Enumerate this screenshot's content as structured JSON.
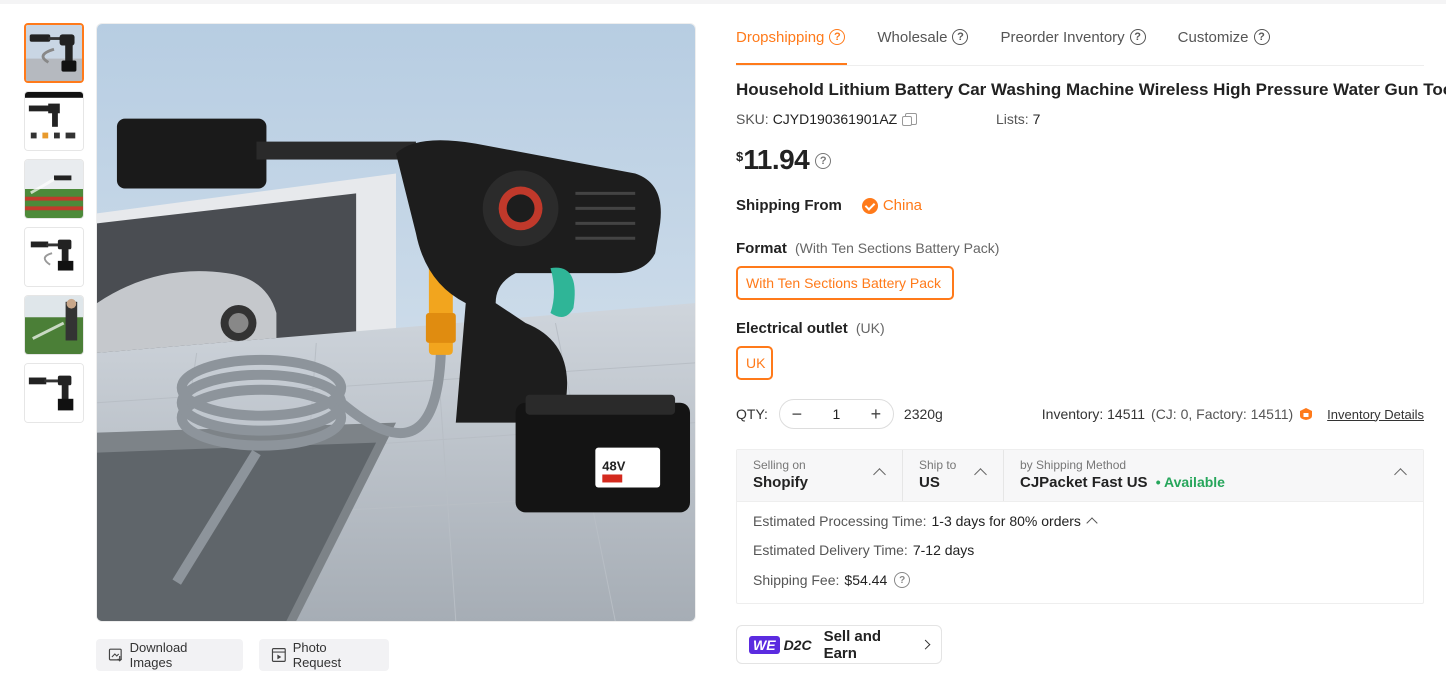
{
  "tabs": [
    {
      "label": "Dropshipping",
      "active": true
    },
    {
      "label": "Wholesale",
      "active": false
    },
    {
      "label": "Preorder Inventory",
      "active": false
    },
    {
      "label": "Customize",
      "active": false
    }
  ],
  "product": {
    "title": "Household Lithium Battery Car Washing Machine Wireless High Pressure Water Gun Tool",
    "sku_label": "SKU:",
    "sku": "CJYD190361901AZ",
    "lists_label": "Lists:",
    "lists": "7",
    "currency": "$",
    "price": "11.94"
  },
  "shipping_from": {
    "label": "Shipping From",
    "country": "China"
  },
  "format": {
    "label": "Format",
    "selected_hint": "(With Ten Sections Battery Pack)",
    "option": "With Ten Sections Battery Pack"
  },
  "outlet": {
    "label": "Electrical outlet",
    "selected_hint": "(UK)",
    "option": "UK"
  },
  "qty": {
    "label": "QTY:",
    "value": "1",
    "minus": "−",
    "plus": "+",
    "weight": "2320g"
  },
  "inventory": {
    "label": "Inventory: 14511",
    "detail": "(CJ: 0, Factory: 14511)",
    "link": "Inventory Details"
  },
  "shipping": {
    "selling_on_label": "Selling on",
    "selling_on": "Shopify",
    "ship_to_label": "Ship to",
    "ship_to": "US",
    "method_label": "by Shipping Method",
    "method": "CJPacket Fast US",
    "availability": "• Available",
    "processing_label": "Estimated Processing Time:",
    "processing": "1-3 days for 80% orders",
    "delivery_label": "Estimated Delivery Time:",
    "delivery": "7-12 days",
    "fee_label": "Shipping Fee:",
    "fee": "$54.44"
  },
  "image_buttons": {
    "download": "Download Images",
    "photo": "Photo Request"
  },
  "d2c": {
    "we": "WE",
    "d2c": "D2C",
    "label": "Sell and Earn"
  },
  "battery_text": "48V",
  "colors": {
    "accent": "#ff7a1a",
    "available": "#26a65b",
    "we_badge": "#5b2be0"
  }
}
